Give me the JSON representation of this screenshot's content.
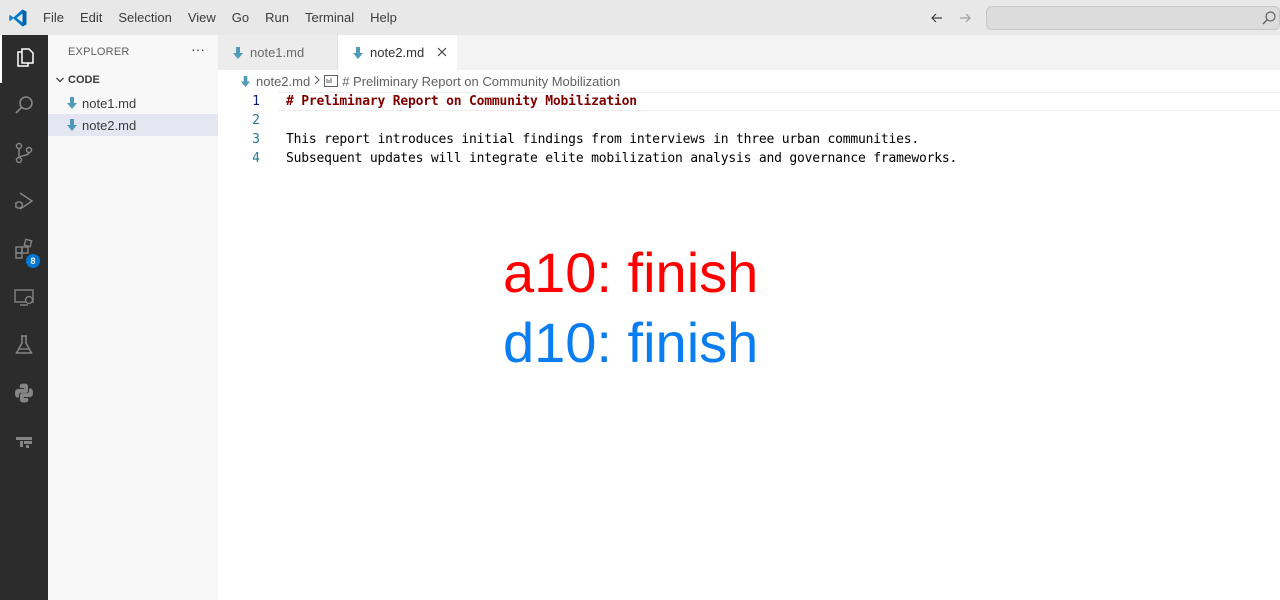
{
  "menu": [
    "File",
    "Edit",
    "Selection",
    "View",
    "Go",
    "Run",
    "Terminal",
    "Help"
  ],
  "icons": {
    "app": "vscode-logo-icon",
    "back": "arrow-left-icon",
    "forward": "arrow-right-icon",
    "search": "search-icon",
    "activity": [
      "files-icon",
      "search-icon",
      "source-control-icon",
      "run-debug-icon",
      "extensions-icon",
      "remote-explorer-icon",
      "testing-icon",
      "python-icon",
      "gitlens-icon"
    ],
    "markdown_file": "markdown-arrow-icon",
    "close": "close-icon"
  },
  "activitybar": {
    "extensions_badge": "8"
  },
  "sidebar": {
    "title": "EXPLORER",
    "more": "···",
    "section": "CODE",
    "files": [
      {
        "label": "note1.md",
        "selected": false
      },
      {
        "label": "note2.md",
        "selected": true
      }
    ]
  },
  "tabs": [
    {
      "label": "note1.md",
      "active": false
    },
    {
      "label": "note2.md",
      "active": true
    }
  ],
  "breadcrumb": {
    "file": "note2.md",
    "symbol": "# Preliminary Report on Community Mobilization"
  },
  "editor": {
    "lines": [
      {
        "number": "1",
        "text": "# Preliminary Report on Community Mobilization"
      },
      {
        "number": "2",
        "text": ""
      },
      {
        "number": "3",
        "text": "This report introduces initial findings from interviews in three urban communities."
      },
      {
        "number": "4",
        "text": "Subsequent updates will integrate elite mobilization analysis and governance frameworks."
      }
    ]
  },
  "overlay": {
    "line1": "a10: finish",
    "line2": "d10: finish"
  },
  "colors": {
    "overlay_red": "#ff0000",
    "overlay_blue": "#0a7ef0",
    "accent": "#0078d4",
    "md_icon": "#519aba"
  }
}
